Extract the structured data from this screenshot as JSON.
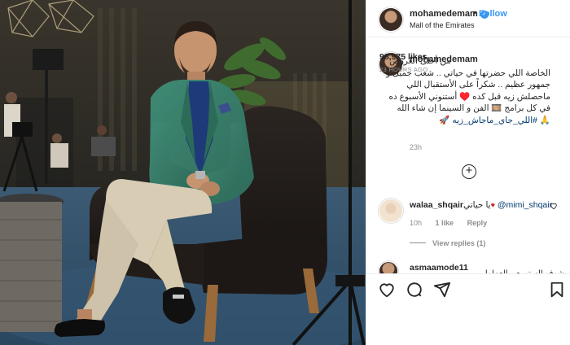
{
  "post": {
    "username": "mohamedemam",
    "verified_mark": "✔",
    "dot": "•",
    "follow_label": "Follow",
    "location": "Mall of the Emirates",
    "more_icon": "more-horizontal-icon",
    "more_glyph": "···"
  },
  "caption": {
    "username": "mohamedemam",
    "text": "من أحلى العروض الخاصة اللي حضرتها في حياتي .. شعب جميل و جمهور عظيم .. شكراً على الأستقبال اللي ماحصلش زيه قبل كده ♥️ أستنوني الأسبوع ده في كل برامج 🎞️ الفن و السينما إن شاء الله 🙏",
    "hashtag": "#اللي_جاي_ماجاش_زيه",
    "hashtag_emoji": "🚀",
    "time": "23h"
  },
  "load_more": {
    "icon": "plus-circle-icon",
    "glyph": "+"
  },
  "comments": [
    {
      "username": "walaa_shqair",
      "mention": "@mimi_shqair",
      "text": "يا حياتي",
      "heart": "♥",
      "time": "10h",
      "likes": "1 like",
      "reply": "Reply",
      "view_replies": "View replies (1)"
    },
    {
      "username": "asmaamode11",
      "text": "شوفو الستوري والعملولي"
    }
  ],
  "actions": {
    "like_icon": "heart-icon",
    "comment_icon": "comment-icon",
    "share_icon": "send-icon",
    "save_icon": "bookmark-icon"
  },
  "likes": "98,975 likes",
  "posted": "23 HOURS AGO",
  "colors": {
    "link_blue": "#3897f0",
    "hashtag": "#00376b",
    "muted": "#8e8e8e",
    "text": "#262626",
    "border": "#efefef"
  }
}
